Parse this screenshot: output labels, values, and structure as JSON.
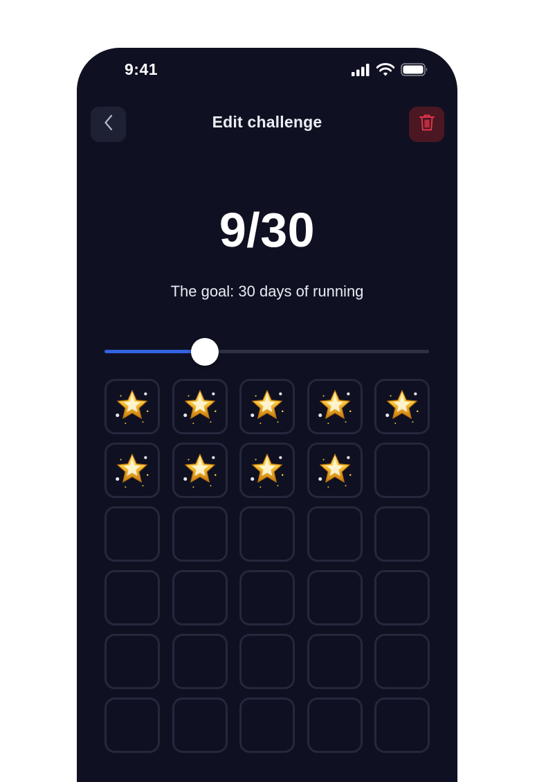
{
  "status": {
    "time": "9:41"
  },
  "header": {
    "title": "Edit challenge",
    "back_icon": "chevron-left-icon",
    "delete_icon": "trash-icon"
  },
  "progress": {
    "text": "9/30",
    "completed": 9,
    "total": 30
  },
  "goal": {
    "text": "The goal: 30 days of running"
  },
  "slider": {
    "value_fraction": 0.31
  },
  "days": {
    "visible_cells": 30,
    "completed_icon": "star-icon"
  },
  "colors": {
    "background": "#0f1122",
    "accent": "#3462e0",
    "danger": "#e0354b",
    "cell_border": "#25283d"
  }
}
